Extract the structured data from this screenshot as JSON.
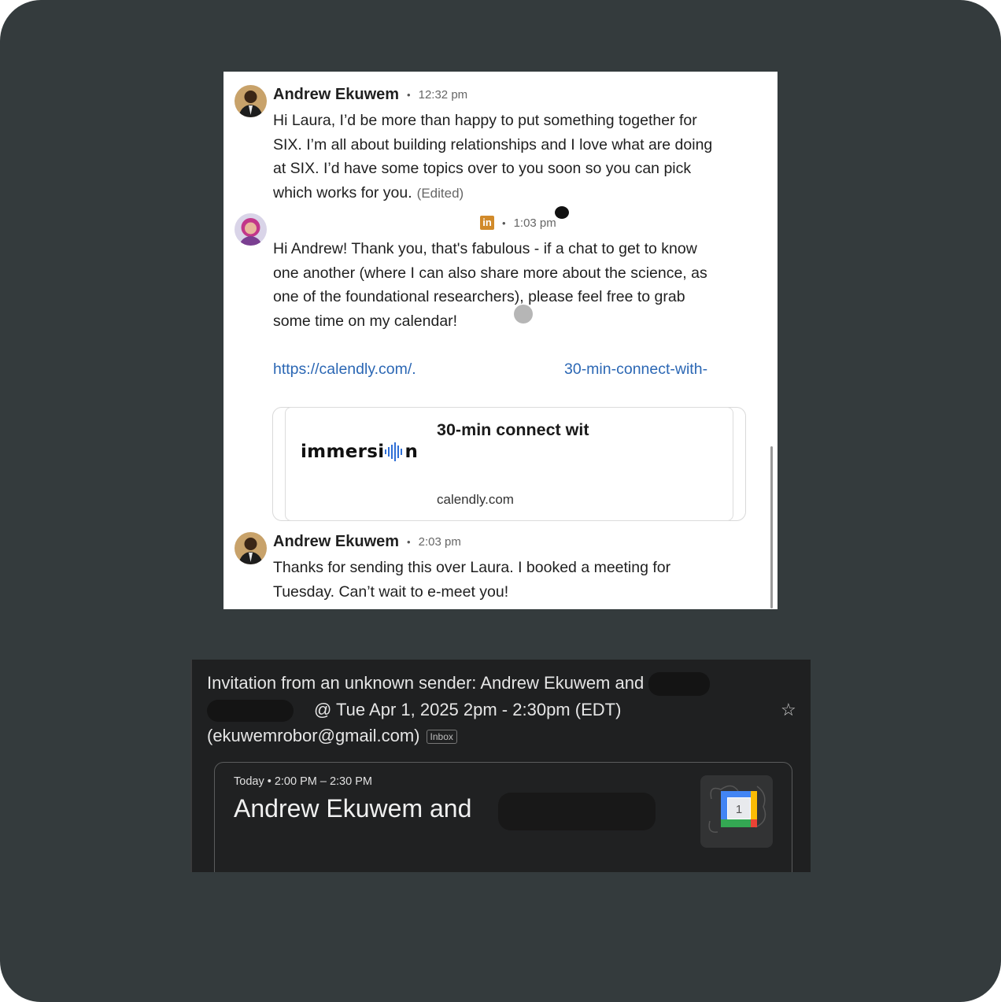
{
  "chat": {
    "messages": [
      {
        "author": "Andrew Ekuwem",
        "separator": "•",
        "time": "12:32 pm",
        "lines": [
          "Hi Laura, I’d be more than happy to put something together for",
          "SIX. I’m all about building relationships and I love what are doing",
          "at SIX. I’d have some topics over to you soon so you can pick",
          "which works for you."
        ],
        "edited": "(Edited)"
      },
      {
        "badge": "in",
        "separator": "•",
        "time": "1:03 pm",
        "lines": [
          "Hi Andrew! Thank you, that's fabulous - if a chat to get to know",
          "one another (where I can also share more about the science, as",
          "one of the foundational researchers), please feel free to grab",
          "some time on my calendar!"
        ],
        "link_start": "https://calendly.com/.",
        "link_end": "30-min-connect-with-",
        "card": {
          "logo_left": "immersi",
          "logo_right": "n",
          "title": "30-min connect wit",
          "domain": "calendly.com"
        }
      },
      {
        "author": "Andrew Ekuwem",
        "separator": "•",
        "time": "2:03 pm",
        "lines": [
          "Thanks for sending this over Laura. I booked a meeting for",
          "Tuesday. Can’t wait to e-meet you!"
        ]
      }
    ]
  },
  "email": {
    "subject_line1": "Invitation from an unknown sender: Andrew Ekuwem and",
    "subject_line2": "@ Tue Apr 1, 2025 2pm - 2:30pm (EDT)",
    "subject_line3": "(ekuwemrobor@gmail.com)",
    "tag": "Inbox",
    "event_when": "Today • 2:00 PM – 2:30 PM",
    "event_title": "Andrew Ekuwem and",
    "calendar_day": "1"
  },
  "colors": {
    "background": "#343b3d",
    "link": "#2b67b4",
    "linkedin_badge": "#d18a2a",
    "email_bg": "#1f2021"
  }
}
